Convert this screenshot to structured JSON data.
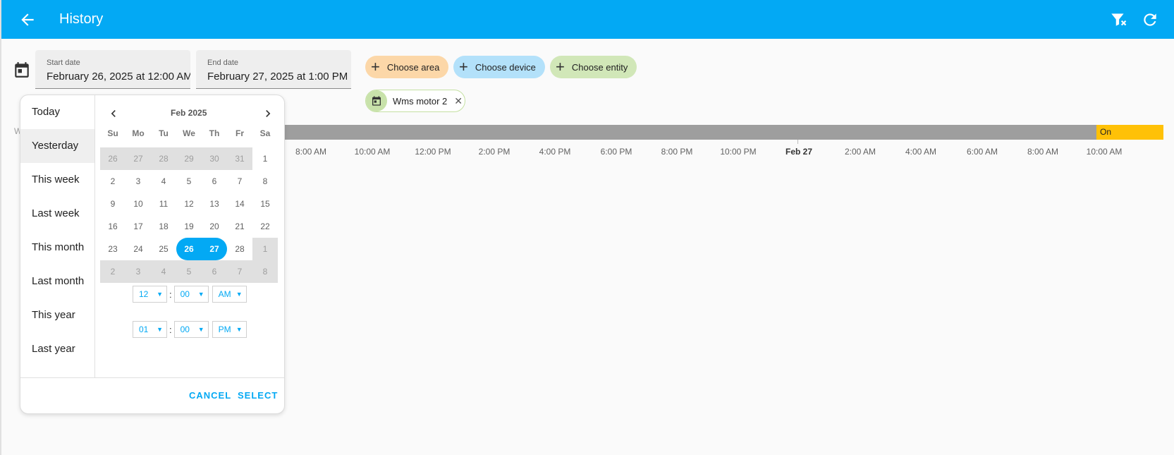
{
  "toolbar": {
    "title": "History",
    "back_icon": "arrow-left-icon",
    "filter_icon": "filter-remove-icon",
    "refresh_icon": "refresh-icon",
    "color": "#03a9f4"
  },
  "date_range": {
    "start_label": "Start date",
    "start_value": "February 26, 2025 at 12:00 AM",
    "end_label": "End date",
    "end_value": "February 27, 2025 at 1:00 PM",
    "calendar_icon": "calendar-icon"
  },
  "targets": {
    "choose_area": "Choose area",
    "choose_device": "Choose device",
    "choose_entity": "Choose entity",
    "selected_entity": "Wms motor 2"
  },
  "timeline": {
    "on_label": "On",
    "ticks": [
      "8:00 AM",
      "10:00 AM",
      "12:00 PM",
      "2:00 PM",
      "4:00 PM",
      "6:00 PM",
      "8:00 PM",
      "10:00 PM",
      "Feb 27",
      "2:00 AM",
      "4:00 AM",
      "6:00 AM",
      "8:00 AM",
      "10:00 AM"
    ],
    "partial_label": "W",
    "colors": {
      "off": "#9e9e9e",
      "on": "#ffc107"
    }
  },
  "picker": {
    "ranges": [
      "Today",
      "Yesterday",
      "This week",
      "Last week",
      "This month",
      "Last month",
      "This year",
      "Last year"
    ],
    "active_range": "Yesterday",
    "month_label": "Feb 2025",
    "weekdays": [
      "Su",
      "Mo",
      "Tu",
      "We",
      "Th",
      "Fr",
      "Sa"
    ],
    "weeks": [
      [
        "26",
        "27",
        "28",
        "29",
        "30",
        "31",
        "1"
      ],
      [
        "2",
        "3",
        "4",
        "5",
        "6",
        "7",
        "8"
      ],
      [
        "9",
        "10",
        "11",
        "12",
        "13",
        "14",
        "15"
      ],
      [
        "16",
        "17",
        "18",
        "19",
        "20",
        "21",
        "22"
      ],
      [
        "23",
        "24",
        "25",
        "26",
        "27",
        "28",
        "1"
      ],
      [
        "2",
        "3",
        "4",
        "5",
        "6",
        "7",
        "8"
      ]
    ],
    "start_time": {
      "hour": "12",
      "minute": "00",
      "period": "AM"
    },
    "end_time": {
      "hour": "01",
      "minute": "00",
      "period": "PM"
    },
    "cancel": "CANCEL",
    "select": "SELECT"
  }
}
